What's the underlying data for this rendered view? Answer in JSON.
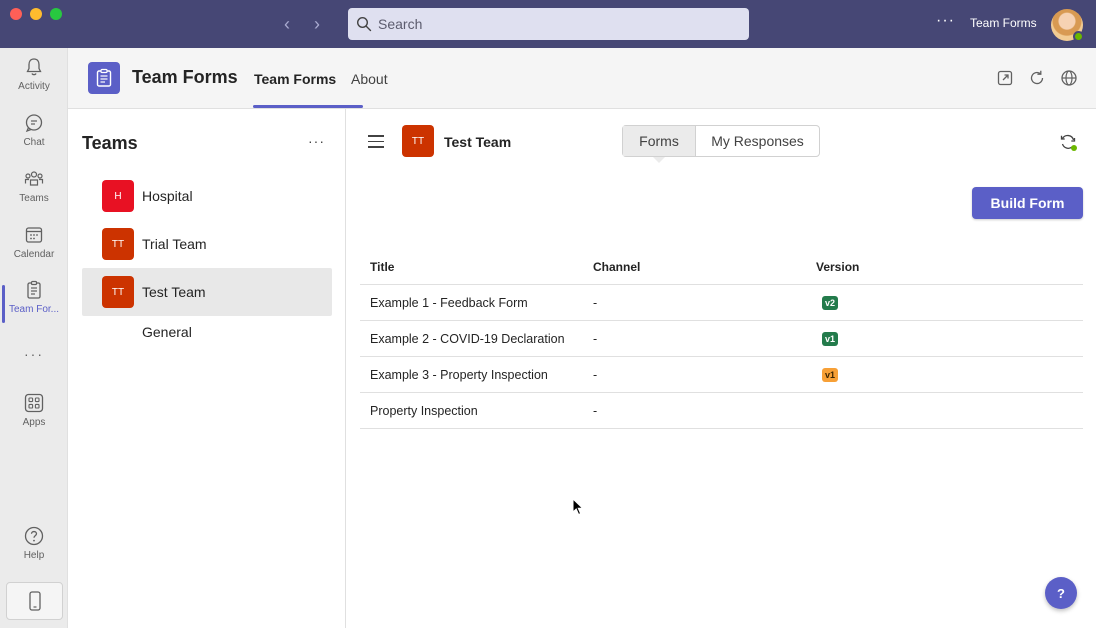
{
  "titlebar": {
    "search_placeholder": "Search",
    "app_name": "Team Forms",
    "more_label": "···"
  },
  "rail": {
    "items": [
      {
        "label": "Activity",
        "icon": "bell-icon"
      },
      {
        "label": "Chat",
        "icon": "chat-icon"
      },
      {
        "label": "Teams",
        "icon": "people-icon"
      },
      {
        "label": "Calendar",
        "icon": "calendar-icon"
      },
      {
        "label": "Team For...",
        "icon": "forms-icon",
        "active": true
      },
      {
        "label": "Apps",
        "icon": "apps-icon"
      },
      {
        "label": "Help",
        "icon": "help-icon"
      }
    ],
    "more_label": "···"
  },
  "header": {
    "title": "Team Forms",
    "tabs": [
      {
        "label": "Team Forms",
        "active": true
      },
      {
        "label": "About"
      }
    ]
  },
  "teams_pane": {
    "title": "Teams",
    "more_label": "···",
    "teams": [
      {
        "initials": "H",
        "name": "Hospital",
        "color": "#e81123"
      },
      {
        "initials": "TT",
        "name": "Trial Team",
        "color": "#cc3300"
      },
      {
        "initials": "TT",
        "name": "Test Team",
        "color": "#cc3300",
        "selected": true
      }
    ],
    "channel": "General"
  },
  "main": {
    "team_initials": "TT",
    "team_name": "Test Team",
    "segments": [
      "Forms",
      "My Responses"
    ],
    "build_button": "Build Form",
    "table": {
      "headers": [
        "Title",
        "Channel",
        "Version"
      ],
      "rows": [
        {
          "title": "Example 1 - Feedback Form",
          "channel": "-",
          "version": "v2",
          "version_color": "#237b4b"
        },
        {
          "title": "Example 2 - COVID-19 Declaration",
          "channel": "-",
          "version": "v1",
          "version_color": "#237b4b"
        },
        {
          "title": "Example 3 - Property Inspection",
          "channel": "-",
          "version": "v1",
          "version_color": "#f7a036"
        },
        {
          "title": "Property Inspection",
          "channel": "-",
          "version": ""
        }
      ]
    },
    "help_label": "?"
  },
  "colors": {
    "titlebar": "#464775",
    "accent": "#5b5fc7"
  }
}
